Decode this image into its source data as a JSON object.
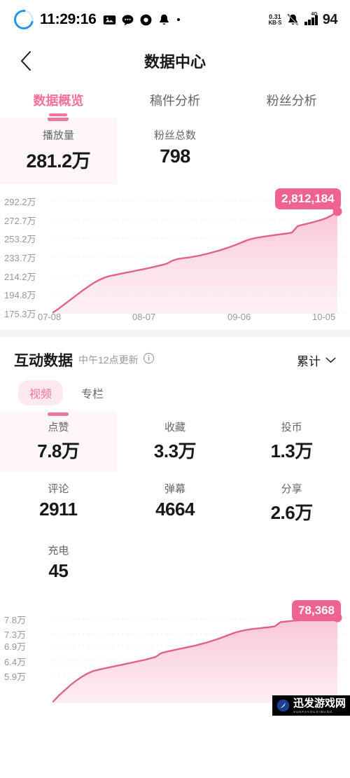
{
  "statusbar": {
    "time": "11:29:16",
    "net_speed_value": "0.31",
    "net_speed_unit": "KB·S",
    "network_type": "4G",
    "battery": "94",
    "icons": [
      "loading-ring-icon",
      "image-icon",
      "chat-bubble-icon",
      "record-icon",
      "bell-icon",
      "dot-icon",
      "mute-bell-icon",
      "signal-bars-icon"
    ]
  },
  "nav": {
    "back_icon": "chevron-left-icon",
    "title": "数据中心"
  },
  "tabs": [
    {
      "label": "数据概览",
      "active": true
    },
    {
      "label": "稿件分析",
      "active": false
    },
    {
      "label": "粉丝分析",
      "active": false
    }
  ],
  "overview": {
    "stats": [
      {
        "label": "播放量",
        "value": "281.2万",
        "selected": true
      },
      {
        "label": "粉丝总数",
        "value": "798",
        "selected": false
      }
    ]
  },
  "interaction": {
    "title": "互动数据",
    "subtitle": "中午12点更新",
    "info_icon": "info-circle-icon",
    "range_label": "累计",
    "range_icon": "chevron-down-icon",
    "pills": [
      {
        "label": "视频",
        "active": true
      },
      {
        "label": "专栏",
        "active": false
      }
    ],
    "metrics": [
      {
        "label": "点赞",
        "value": "7.8万",
        "selected": true
      },
      {
        "label": "收藏",
        "value": "3.3万",
        "selected": false
      },
      {
        "label": "投币",
        "value": "1.3万",
        "selected": false
      },
      {
        "label": "评论",
        "value": "2911",
        "selected": false
      },
      {
        "label": "弹幕",
        "value": "4664",
        "selected": false
      },
      {
        "label": "分享",
        "value": "2.6万",
        "selected": false
      },
      {
        "label": "充电",
        "value": "45",
        "selected": false
      }
    ]
  },
  "watermark": {
    "text": "迅发游戏网",
    "sub": "XUNFAYOUXIWANG",
    "logo_icon": "watermark-logo-icon"
  },
  "colors": {
    "accent": "#fb7299",
    "line": "#e0628a",
    "tooltip": "#f06292",
    "area_top": "#fac2d3",
    "area_bottom": "#fde8ef",
    "selected_bg": "#fef6f8",
    "muted_text": "#9499a0"
  },
  "chart_data": [
    {
      "type": "area",
      "id": "plays-chart",
      "title": "播放量",
      "xlabel": "",
      "ylabel": "",
      "grid": true,
      "legend": "none",
      "tooltip_value": "2,812,184",
      "ytick_labels": [
        "292.2万",
        "272.7万",
        "253.2万",
        "233.7万",
        "214.2万",
        "194.8万",
        "175.3万"
      ],
      "yticks": [
        2922000,
        2727000,
        2532000,
        2337000,
        2142000,
        1948000,
        1753000
      ],
      "ylim": [
        1753000,
        2922000
      ],
      "xtick_labels": [
        "07-08",
        "08-07",
        "09-06",
        "10-05"
      ],
      "x": [
        0,
        2,
        4,
        6,
        8,
        10,
        12,
        14,
        16,
        18,
        20,
        22,
        24,
        26,
        28,
        30,
        32,
        34,
        36,
        38,
        40,
        42,
        44,
        46,
        48,
        50,
        52,
        54,
        56,
        58,
        60,
        62,
        64,
        66,
        68,
        70,
        72,
        74,
        76,
        78,
        80,
        82,
        84,
        86,
        88,
        90,
        92,
        94,
        96,
        98,
        100
      ],
      "values": [
        1760000,
        1800000,
        1845000,
        1890000,
        1935000,
        1980000,
        2022000,
        2062000,
        2096000,
        2122000,
        2140000,
        2152000,
        2164000,
        2176000,
        2188000,
        2200000,
        2212000,
        2224000,
        2238000,
        2252000,
        2268000,
        2300000,
        2318000,
        2326000,
        2334000,
        2344000,
        2356000,
        2370000,
        2386000,
        2402000,
        2420000,
        2440000,
        2462000,
        2486000,
        2510000,
        2528000,
        2540000,
        2550000,
        2558000,
        2566000,
        2574000,
        2582000,
        2592000,
        2660000,
        2676000,
        2690000,
        2706000,
        2722000,
        2742000,
        2772000,
        2812184
      ]
    },
    {
      "type": "area",
      "id": "likes-chart",
      "title": "点赞",
      "xlabel": "",
      "ylabel": "",
      "grid": true,
      "legend": "none",
      "tooltip_value": "78,368",
      "ytick_labels": [
        "7.8万",
        "7.3万",
        "6.9万",
        "6.4万",
        "5.9万"
      ],
      "yticks": [
        78000,
        73000,
        69000,
        64000,
        59000
      ],
      "ylim": [
        50000,
        80000
      ],
      "xtick_labels": [],
      "x": [
        0,
        2,
        4,
        6,
        8,
        10,
        12,
        14,
        16,
        18,
        20,
        22,
        24,
        26,
        28,
        30,
        32,
        34,
        36,
        38,
        40,
        42,
        44,
        46,
        48,
        50,
        52,
        54,
        56,
        58,
        60,
        62,
        64,
        66,
        68,
        70,
        72,
        74,
        76,
        78,
        80,
        82,
        84,
        86,
        88,
        90,
        92,
        94,
        96,
        98,
        100
      ],
      "values": [
        50500,
        52500,
        54200,
        55900,
        57400,
        58700,
        59800,
        60600,
        61100,
        61500,
        61900,
        62300,
        62700,
        63100,
        63500,
        63900,
        64300,
        64800,
        65300,
        66600,
        67100,
        67500,
        67900,
        68300,
        68700,
        69100,
        69600,
        70100,
        70700,
        71300,
        72000,
        72700,
        73400,
        73900,
        74300,
        74600,
        74800,
        75000,
        75200,
        75500,
        76900,
        77100,
        77300,
        77450,
        77600,
        77750,
        77900,
        78000,
        78120,
        78250,
        78368
      ]
    }
  ]
}
